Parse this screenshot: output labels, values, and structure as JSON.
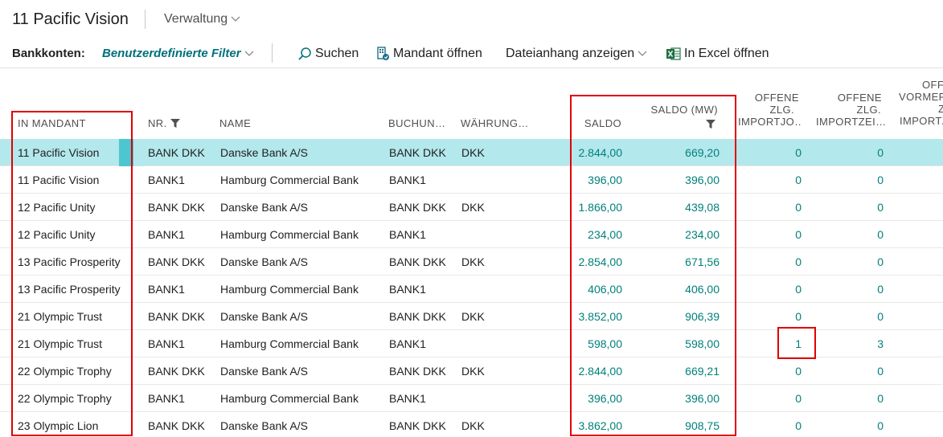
{
  "header": {
    "company": "11 Pacific Vision",
    "admin_menu": "Verwaltung"
  },
  "actions": {
    "caption": "Bankkonten:",
    "filter": "Benutzerdefinierte Filter",
    "search": "Suchen",
    "open_company": "Mandant öffnen",
    "attachments": "Dateianhang anzeigen",
    "excel": "In Excel öffnen"
  },
  "columns": {
    "company": "IN MANDANT",
    "no": "NR.",
    "name": "NAME",
    "posting": "BUCHUN…",
    "currency": "WÄHRUNG…",
    "balance": "SALDO",
    "balance_lcy": "SALDO (MW)",
    "open_journal_1": "OFFENE",
    "open_journal_2": "ZLG.",
    "open_journal_3": "IMPORTJO…",
    "open_lines_1": "OFFENE",
    "open_lines_2": "ZLG.",
    "open_lines_3": "IMPORTZEI…",
    "pending_1": "OFF",
    "pending_2": "VORMER",
    "pending_3": "Z",
    "pending_4": "IMPORTZ"
  },
  "rows": [
    {
      "company": "11 Pacific Vision",
      "no": "BANK DKK",
      "name": "Danske Bank A/S",
      "posting": "BANK DKK",
      "currency": "DKK",
      "balance": "2.844,00",
      "balance_lcy": "669,20",
      "open_journal": "0",
      "open_lines": "0"
    },
    {
      "company": "11 Pacific Vision",
      "no": "BANK1",
      "name": "Hamburg Commercial Bank",
      "posting": "BANK1",
      "currency": "",
      "balance": "396,00",
      "balance_lcy": "396,00",
      "open_journal": "0",
      "open_lines": "0"
    },
    {
      "company": "12 Pacific Unity",
      "no": "BANK DKK",
      "name": "Danske Bank A/S",
      "posting": "BANK DKK",
      "currency": "DKK",
      "balance": "1.866,00",
      "balance_lcy": "439,08",
      "open_journal": "0",
      "open_lines": "0"
    },
    {
      "company": "12 Pacific Unity",
      "no": "BANK1",
      "name": "Hamburg Commercial Bank",
      "posting": "BANK1",
      "currency": "",
      "balance": "234,00",
      "balance_lcy": "234,00",
      "open_journal": "0",
      "open_lines": "0"
    },
    {
      "company": "13 Pacific Prosperity",
      "no": "BANK DKK",
      "name": "Danske Bank A/S",
      "posting": "BANK DKK",
      "currency": "DKK",
      "balance": "2.854,00",
      "balance_lcy": "671,56",
      "open_journal": "0",
      "open_lines": "0"
    },
    {
      "company": "13 Pacific Prosperity",
      "no": "BANK1",
      "name": "Hamburg Commercial Bank",
      "posting": "BANK1",
      "currency": "",
      "balance": "406,00",
      "balance_lcy": "406,00",
      "open_journal": "0",
      "open_lines": "0"
    },
    {
      "company": "21 Olympic Trust",
      "no": "BANK DKK",
      "name": "Danske Bank A/S",
      "posting": "BANK DKK",
      "currency": "DKK",
      "balance": "3.852,00",
      "balance_lcy": "906,39",
      "open_journal": "0",
      "open_lines": "0"
    },
    {
      "company": "21 Olympic Trust",
      "no": "BANK1",
      "name": "Hamburg Commercial Bank",
      "posting": "BANK1",
      "currency": "",
      "balance": "598,00",
      "balance_lcy": "598,00",
      "open_journal": "1",
      "open_lines": "3"
    },
    {
      "company": "22 Olympic Trophy",
      "no": "BANK DKK",
      "name": "Danske Bank A/S",
      "posting": "BANK DKK",
      "currency": "DKK",
      "balance": "2.844,00",
      "balance_lcy": "669,21",
      "open_journal": "0",
      "open_lines": "0"
    },
    {
      "company": "22 Olympic Trophy",
      "no": "BANK1",
      "name": "Hamburg Commercial Bank",
      "posting": "BANK1",
      "currency": "",
      "balance": "396,00",
      "balance_lcy": "396,00",
      "open_journal": "0",
      "open_lines": "0"
    },
    {
      "company": "23 Olympic Lion",
      "no": "BANK DKK",
      "name": "Danske Bank A/S",
      "posting": "BANK DKK",
      "currency": "DKK",
      "balance": "3.862,00",
      "balance_lcy": "908,75",
      "open_journal": "0",
      "open_lines": "0"
    }
  ],
  "colors": {
    "accent": "#00707c",
    "number": "#00807a",
    "selected_row": "#b3e8ec",
    "highlight": "#e00000"
  },
  "icons": [
    "chevron-down-icon",
    "search-icon",
    "open-company-icon",
    "excel-icon",
    "filter-icon"
  ]
}
